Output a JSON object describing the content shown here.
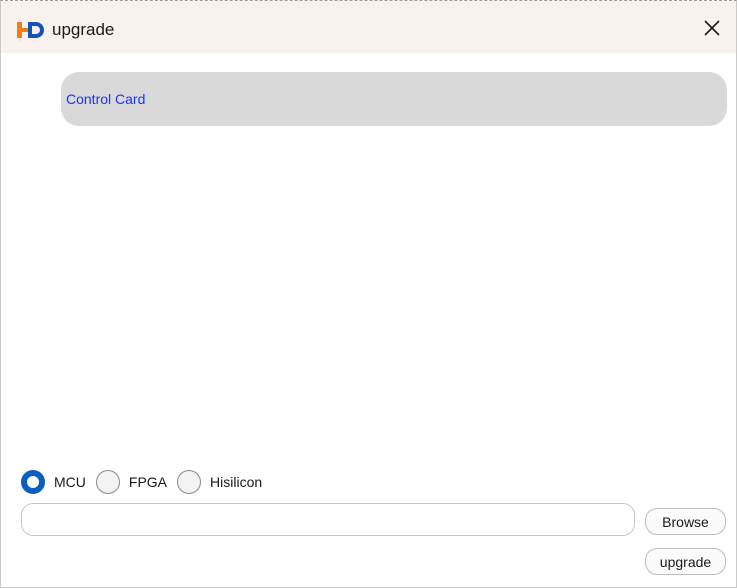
{
  "window": {
    "title": "upgrade",
    "icon": "hd-logo-icon",
    "close_icon": "close-icon",
    "brand_colors": {
      "h_orange": "#f07c1a",
      "d_blue": "#1652b5"
    }
  },
  "device_list": {
    "items": [
      {
        "label": "Control Card",
        "selected": true
      }
    ],
    "item_bg": "#d9d9d9",
    "item_text_color": "#1a33ff"
  },
  "chip_type": {
    "options": [
      {
        "label": "MCU",
        "checked": true
      },
      {
        "label": "FPGA",
        "checked": false
      },
      {
        "label": "Hisilicon",
        "checked": false
      }
    ],
    "accent": "#0a5fbf"
  },
  "file_path": {
    "value": "",
    "placeholder": ""
  },
  "buttons": {
    "browse_label": "Browse",
    "upgrade_label": "upgrade"
  }
}
